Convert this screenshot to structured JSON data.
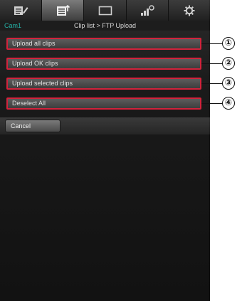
{
  "tabs": [
    {
      "icon": "pencil-document-icon",
      "active": false
    },
    {
      "icon": "clip-list-icon",
      "active": true
    },
    {
      "icon": "monitor-icon",
      "active": false
    },
    {
      "icon": "signal-gear-icon",
      "active": false
    },
    {
      "icon": "gear-icon",
      "active": false
    }
  ],
  "header": {
    "camera": "Cam1",
    "breadcrumb": "Clip list > FTP Upload"
  },
  "menu": [
    {
      "label": "Upload all clips"
    },
    {
      "label": "Upload OK clips"
    },
    {
      "label": "Upload selected clips"
    },
    {
      "label": "Deselect All"
    }
  ],
  "footer": {
    "cancel_label": "Cancel"
  },
  "callouts": [
    "①",
    "②",
    "③",
    "④"
  ],
  "colors": {
    "accent_border": "#d2233c",
    "camera_label": "#24b3a8",
    "background": "#1a1a1a"
  }
}
